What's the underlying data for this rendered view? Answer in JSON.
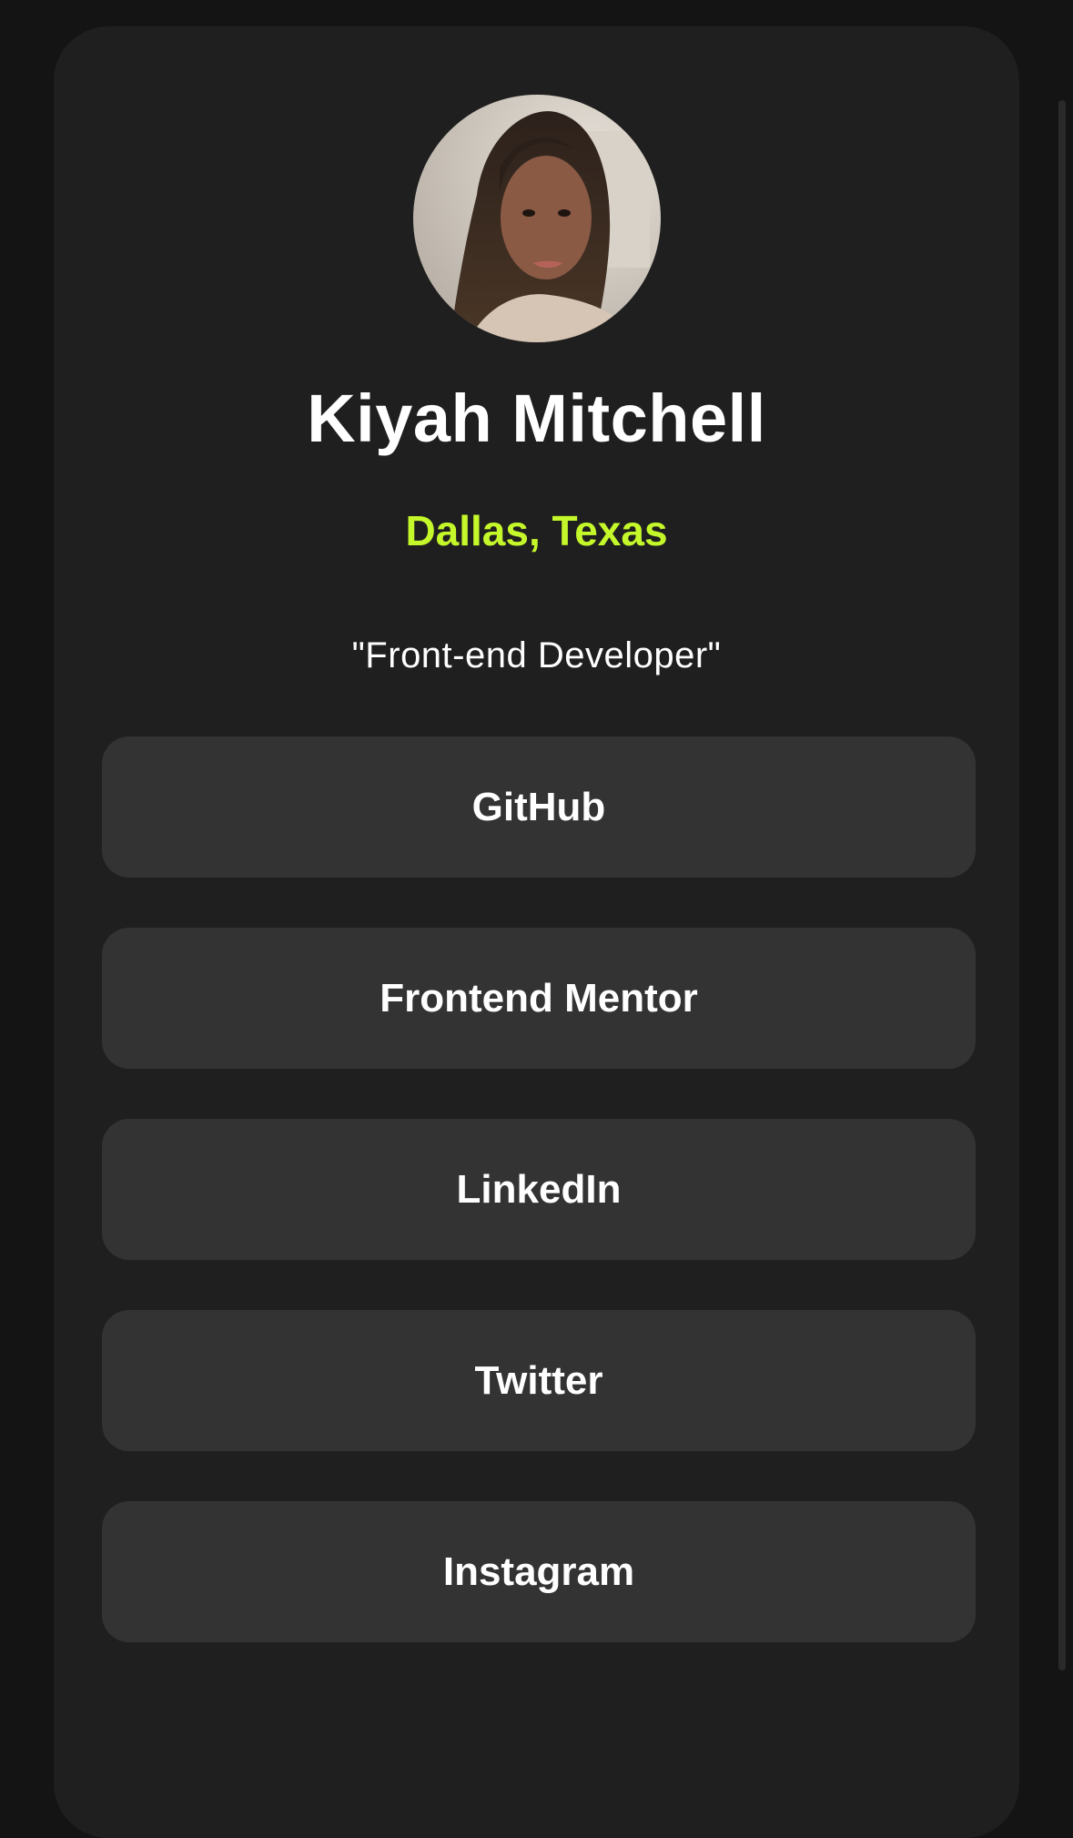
{
  "profile": {
    "name": "Kiyah Mitchell",
    "location": "Dallas, Texas",
    "tagline": "\"Front-end Developer\"",
    "avatar_icon": "profile-photo"
  },
  "links": [
    {
      "label": "GitHub"
    },
    {
      "label": "Frontend Mentor"
    },
    {
      "label": "LinkedIn"
    },
    {
      "label": "Twitter"
    },
    {
      "label": "Instagram"
    }
  ],
  "colors": {
    "page_background": "#141414",
    "card_background": "#1f1f1f",
    "button_background": "#333333",
    "accent": "#c5f82a",
    "text": "#ffffff"
  }
}
